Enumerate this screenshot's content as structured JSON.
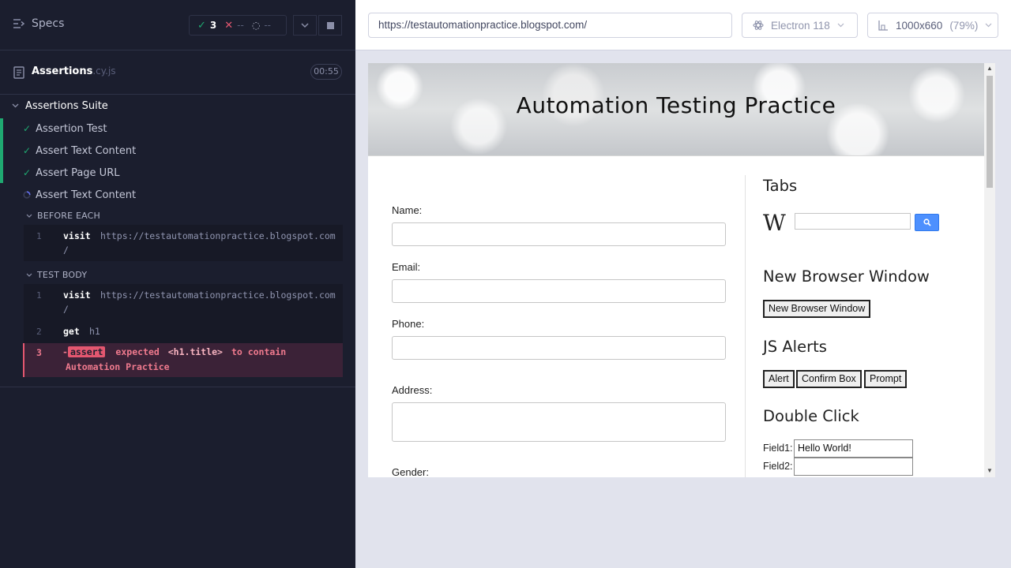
{
  "reporter": {
    "specs_label": "Specs",
    "stats": {
      "passed": "3",
      "failed": "--",
      "pending": "--"
    },
    "spec": {
      "name": "Assertions",
      "ext": ".cy.js",
      "duration": "00:55"
    },
    "suite": {
      "title": "Assertions Suite"
    },
    "tests": [
      {
        "title": "Assertion Test",
        "state": "passed"
      },
      {
        "title": "Assert Text Content",
        "state": "passed"
      },
      {
        "title": "Assert Page URL",
        "state": "passed"
      },
      {
        "title": "Assert Text Content",
        "state": "running"
      }
    ],
    "before_each": {
      "label": "BEFORE EACH",
      "commands": [
        {
          "num": "1",
          "name": "visit",
          "arg": "https://testautomationpractice.blogspot.com",
          "arg_cont": "/"
        }
      ]
    },
    "test_body": {
      "label": "TEST BODY",
      "commands": [
        {
          "num": "1",
          "name": "visit",
          "arg": "https://testautomationpractice.blogspot.com",
          "arg_cont": "/"
        },
        {
          "num": "2",
          "name": "get",
          "arg": "h1"
        }
      ],
      "failed_command": {
        "num": "3",
        "prefix": "-",
        "name": "assert",
        "message_1": "expected",
        "element": "<h1.title>",
        "message_2": "to contain",
        "message_3": "Automation Practice"
      }
    }
  },
  "aut": {
    "url": "https://testautomationpractice.blogspot.com/",
    "browser": "Electron 118",
    "viewport": "1000x660",
    "viewport_scale": "(79%)",
    "page": {
      "title": "Automation Testing Practice",
      "form": {
        "name_label": "Name:",
        "email_label": "Email:",
        "phone_label": "Phone:",
        "address_label": "Address:",
        "gender_label": "Gender:"
      },
      "sidebar": {
        "tabs_title": "Tabs",
        "wiki_logo": "W",
        "new_window_title": "New Browser Window",
        "new_window_button": "New Browser Window",
        "js_alerts_title": "JS Alerts",
        "alert_button": "Alert",
        "confirm_button": "Confirm Box",
        "prompt_button": "Prompt",
        "double_click_title": "Double Click",
        "field1_label": "Field1:",
        "field1_value": "Hello World!",
        "field2_label": "Field2:",
        "field2_value": ""
      }
    }
  },
  "colors": {
    "passed": "#1fa971",
    "failed": "#e45770",
    "running": "#6470f3"
  }
}
